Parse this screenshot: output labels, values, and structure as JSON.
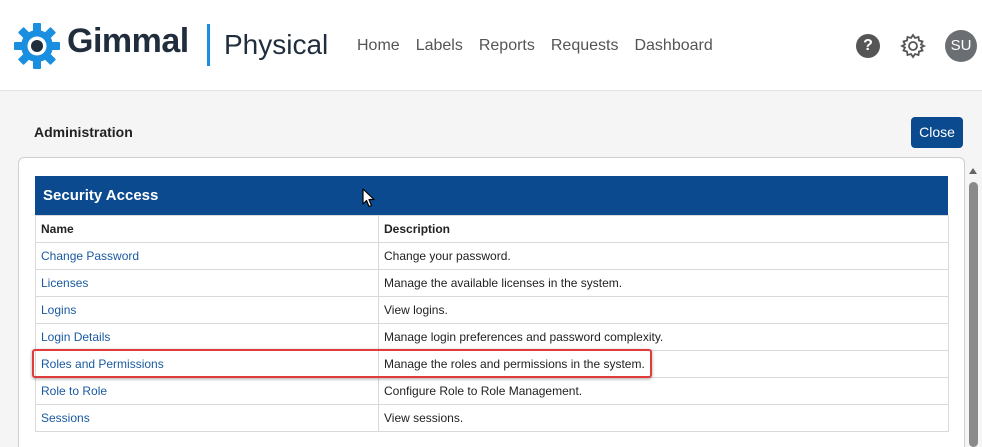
{
  "header": {
    "brand": "Gimmal",
    "product": "Physical",
    "nav": [
      "Home",
      "Labels",
      "Reports",
      "Requests",
      "Dashboard"
    ],
    "help_icon": "question-circle-icon",
    "help_glyph": "?",
    "settings_icon": "gear-icon",
    "avatar_initials": "SU"
  },
  "page": {
    "title": "Administration",
    "close_label": "Close"
  },
  "section": {
    "title": "Security Access",
    "columns": [
      "Name",
      "Description"
    ],
    "rows": [
      {
        "name": "Change Password",
        "description": "Change your password."
      },
      {
        "name": "Licenses",
        "description": "Manage the available licenses in the system."
      },
      {
        "name": "Logins",
        "description": "View logins."
      },
      {
        "name": "Login Details",
        "description": "Manage login preferences and password complexity."
      },
      {
        "name": "Roles and Permissions",
        "description": "Manage the roles and permissions in the system."
      },
      {
        "name": "Role to Role",
        "description": "Configure Role to Role Management."
      },
      {
        "name": "Sessions",
        "description": "View sessions."
      }
    ]
  },
  "colors": {
    "primary": "#0b4a8e",
    "link": "#1a5aa0",
    "accent": "#1a8fe0",
    "highlight": "#e03c3c"
  }
}
